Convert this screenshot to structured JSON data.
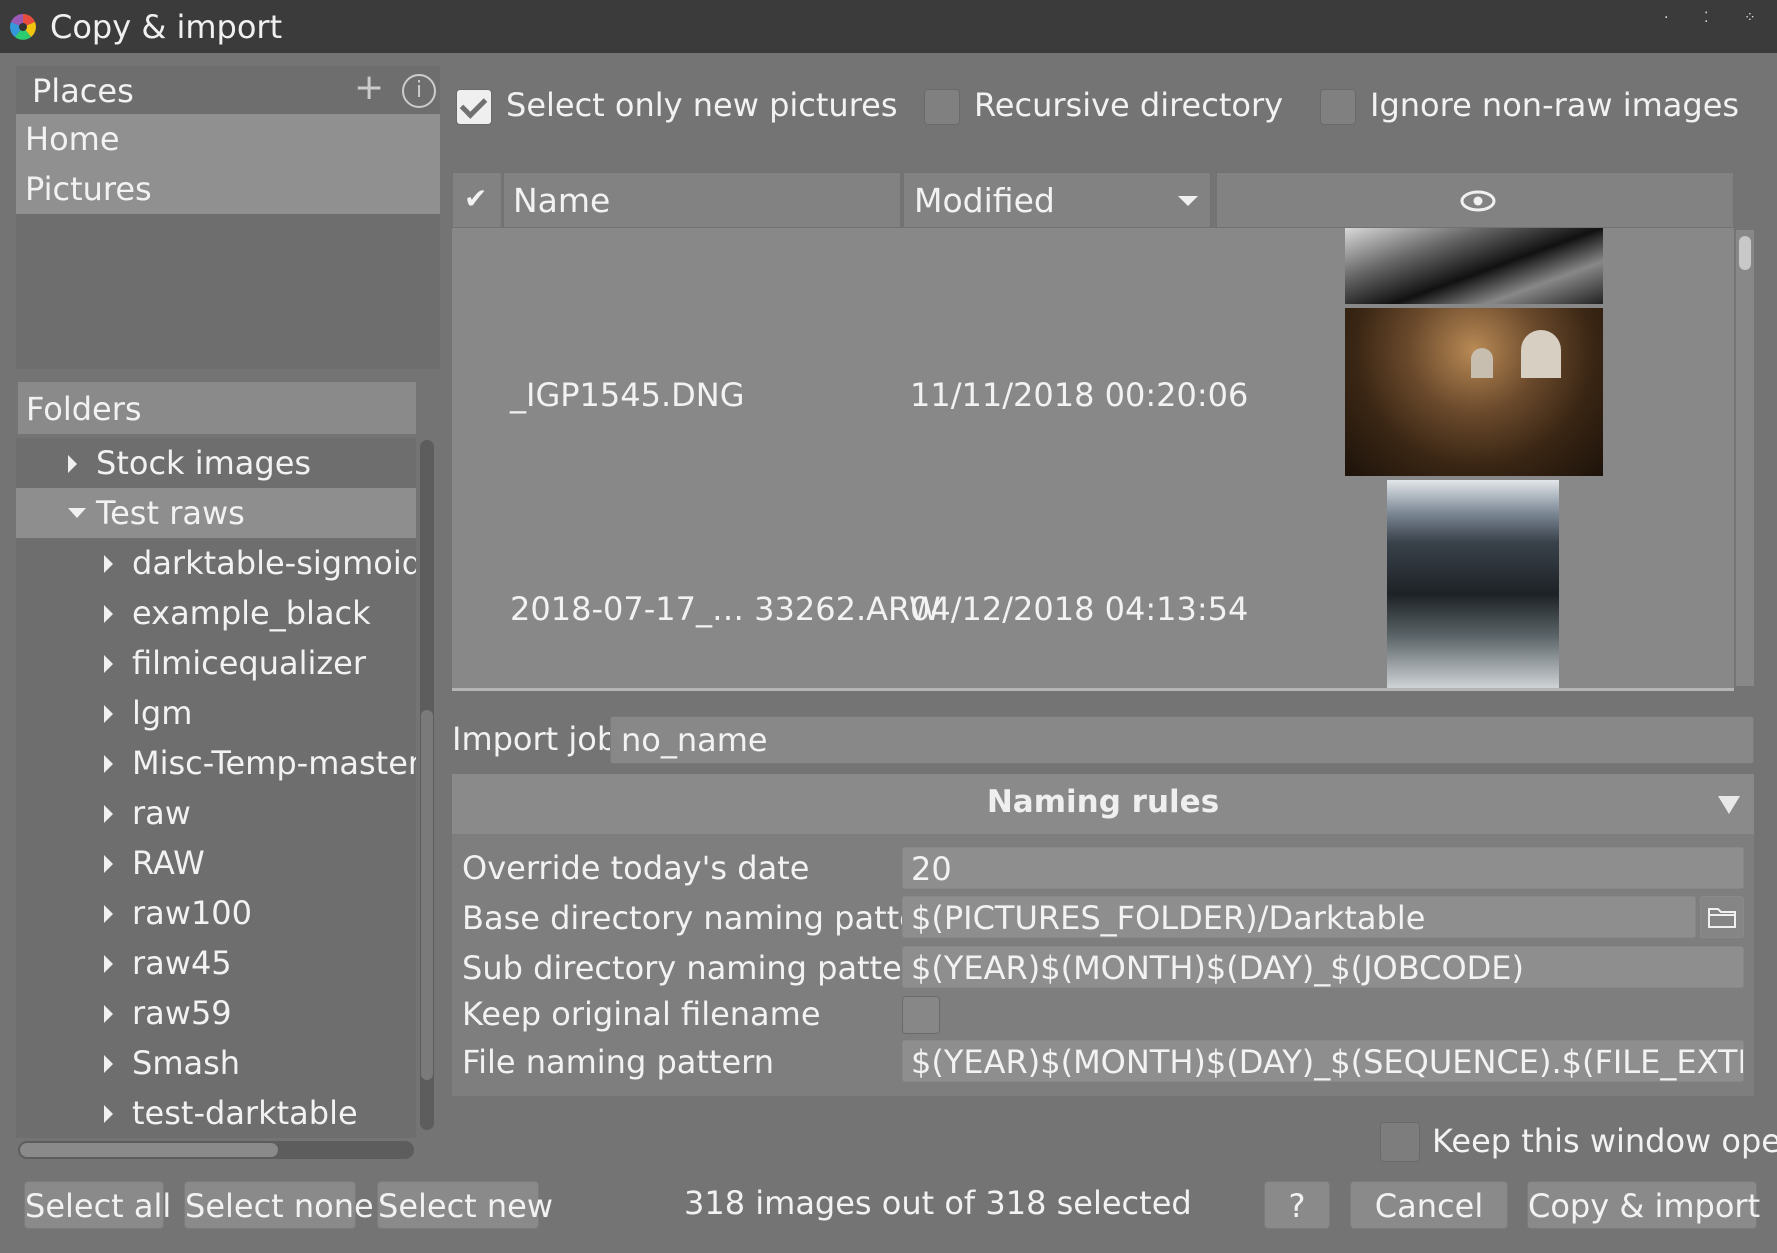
{
  "window": {
    "title": "Copy & import"
  },
  "places": {
    "label": "Places",
    "items": [
      "Home",
      "Pictures"
    ]
  },
  "folders": {
    "label": "Folders",
    "items": [
      {
        "label": "Stock images",
        "expanded": false,
        "depth": 0
      },
      {
        "label": "Test raws",
        "expanded": true,
        "depth": 0,
        "selected": true
      },
      {
        "label": "darktable-sigmoid_t",
        "expanded": false,
        "depth": 1
      },
      {
        "label": "example_black",
        "expanded": false,
        "depth": 1
      },
      {
        "label": "filmicequalizer",
        "expanded": false,
        "depth": 1
      },
      {
        "label": "lgm",
        "expanded": false,
        "depth": 1
      },
      {
        "label": "Misc-Temp-master",
        "expanded": false,
        "depth": 1
      },
      {
        "label": "raw",
        "expanded": false,
        "depth": 1
      },
      {
        "label": "RAW",
        "expanded": false,
        "depth": 1
      },
      {
        "label": "raw100",
        "expanded": false,
        "depth": 1
      },
      {
        "label": "raw45",
        "expanded": false,
        "depth": 1
      },
      {
        "label": "raw59",
        "expanded": false,
        "depth": 1
      },
      {
        "label": "Smash",
        "expanded": false,
        "depth": 1
      },
      {
        "label": "test-darktable",
        "expanded": false,
        "depth": 1
      }
    ]
  },
  "options": {
    "select_only_new": {
      "label": "Select only new pictures",
      "checked": true
    },
    "recursive": {
      "label": "Recursive directory",
      "checked": false
    },
    "ignore_nonraw": {
      "label": "Ignore non-raw images",
      "checked": false
    }
  },
  "file_list": {
    "columns": {
      "check": "✔",
      "name": "Name",
      "modified": "Modified",
      "thumb_icon": "eye-icon"
    },
    "rows": [
      {
        "name": "_IGP1545.DNG",
        "modified": "11/11/2018 00:20:06"
      },
      {
        "name": "2018-07-17_…  33262.ARW",
        "modified": "04/12/2018 04:13:54"
      }
    ]
  },
  "import_job": {
    "label": "Import job",
    "value": "no_name"
  },
  "naming_rules": {
    "title": "Naming rules",
    "override_date": {
      "label": "Override today's date",
      "value": "20"
    },
    "base_dir": {
      "label": "Base directory naming pattern",
      "value": "$(PICTURES_FOLDER)/Darktable"
    },
    "sub_dir": {
      "label": "Sub directory naming pattern",
      "value": "$(YEAR)$(MONTH)$(DAY)_$(JOBCODE)"
    },
    "keep_filename": {
      "label": "Keep original filename",
      "checked": false
    },
    "file_pattern": {
      "label": "File naming pattern",
      "value": "$(YEAR)$(MONTH)$(DAY)_$(SEQUENCE).$(FILE_EXTENSIC"
    }
  },
  "keep_open": {
    "label": "Keep this window open",
    "checked": false
  },
  "footer": {
    "select_all": "Select all",
    "select_none": "Select none",
    "select_new": "Select new",
    "status": "318 images out of 318 selected",
    "help": "?",
    "cancel": "Cancel",
    "copy_import": "Copy & import"
  }
}
